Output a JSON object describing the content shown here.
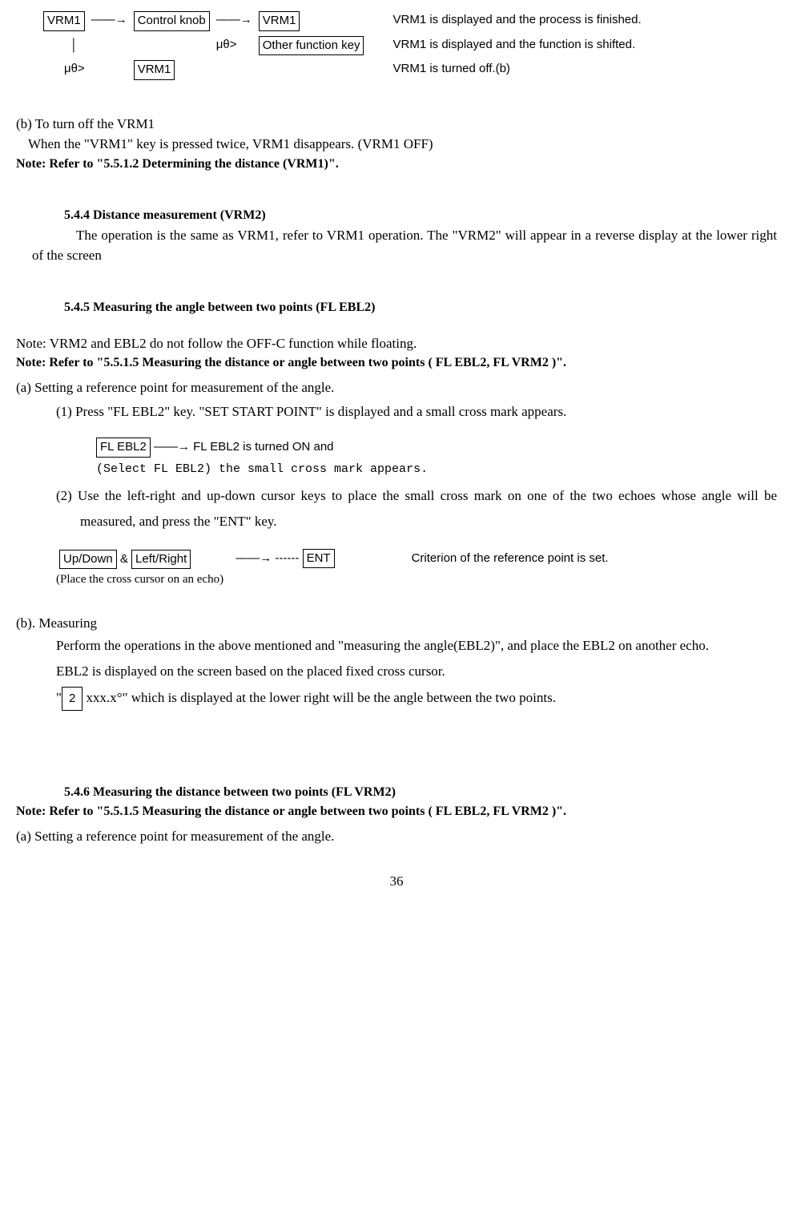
{
  "flow": {
    "vrm1": "VRM1",
    "ctrl": "Control knob",
    "other": "Other function key",
    "arrow": "——→",
    "mu": "μθ>",
    "r1desc": "VRM1 is displayed and the process is finished.",
    "r2desc": "VRM1 is displayed and the function is shifted.",
    "r3desc": "VRM1 is turned off.(b)",
    "flebl2": "FL EBL2",
    "updown": "Up/Down",
    "leftright": "Left/Right",
    "ent": "ENT",
    "boxed2": "2"
  },
  "sec_b_title": "(b)  To turn off the VRM1",
  "sec_b_line": "When the \"VRM1\" key is pressed twice, VRM1 disappears.  (VRM1 OFF)",
  "note1": "Note: Refer to \"5.5.1.2 Determining the distance (VRM1)\".",
  "s544_title": "5.4.4 Distance measurement (VRM2)",
  "s544_body": "The operation is the same as VRM1, refer to VRM1 operation. The \"VRM2\" will appear in a reverse display at the lower right of the screen",
  "s545_title": "5.4.5 Measuring the angle between two points (FL EBL2)",
  "s545_note": "Note:  VRM2 and EBL2 do not follow the OFF-C function while floating.",
  "note2": "Note: Refer to \"5.5.1.5 Measuring the distance or angle between two points ( FL EBL2, FL VRM2 )\".",
  "s545_a": "(a)  Setting a reference point for measurement of the angle.",
  "s545_a1": "(1)  Press \"FL EBL2\" key. \"SET START POINT\" is displayed and a small cross mark appears.",
  "s545_flow1a": " ——→ FL EBL2 is turned ON and",
  "s545_flow1b": "(Select FL EBL2)    the small cross mark appears.",
  "s545_a2": "(2)  Use the left-right and up-down cursor keys to place the small cross mark on one of the two echoes whose angle will be measured, and press the \"ENT\" key.",
  "s545_flow2_amp": " & ",
  "s545_flow2_arr": "——→  ------ ",
  "s545_flow2_desc": "Criterion of the reference point is set.",
  "s545_flow2_cap": "(Place the cross cursor on an echo)",
  "s545_b_title": "(b).  Measuring",
  "s545_b1": "Perform the operations in the above mentioned and \"measuring the angle(EBL2)\", and place the EBL2  on another echo.",
  "s545_b2": "EBL2 is displayed on the screen based on the placed fixed cross cursor.",
  "s545_b3a": "\"",
  "s545_b3b": " xxx.x°\" which is displayed at the lower right will be the angle between the two points.",
  "s546_title": "5.4.6 Measuring the distance between two points (FL VRM2)",
  "s546_a": "(a)  Setting a reference point for measurement of the angle.",
  "pagenum": "36"
}
